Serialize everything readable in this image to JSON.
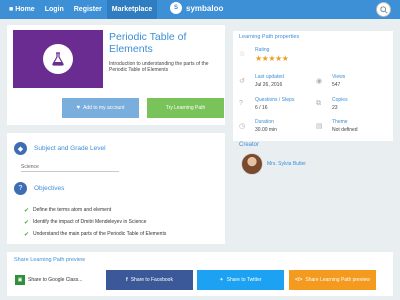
{
  "nav": {
    "home": "Home",
    "login": "Login",
    "register": "Register",
    "marketplace": "Marketplace",
    "logo_text": "symbaloo"
  },
  "path": {
    "title": "Periodic Table of Elements",
    "description": "Introduction to understanding the parts of the Periodic Table of Elements",
    "thumbnail_color": "#6a2c91",
    "add_button": "Add to my account",
    "try_button": "Try Learning Path"
  },
  "subject": {
    "heading": "Subject and Grade Level",
    "value": "Science"
  },
  "objectives": {
    "heading": "Objectives",
    "items": [
      "Define the terms atom and element",
      "Identify the impact of Dmitri Mendeleyev in Science",
      "Understand the main parts of the Periodic Table of Elements"
    ]
  },
  "properties": {
    "title": "Learning Path properties",
    "rating_label": "Rating",
    "rating": 4.5,
    "rating_stars": "★★★★★",
    "last_updated_label": "Last updated",
    "last_updated": "Jul 26, 2016",
    "views_label": "Views",
    "views": "547",
    "questions_label": "Questions / Steps",
    "questions": "6 / 16",
    "copies_label": "Copies",
    "copies": "23",
    "duration_label": "Duration",
    "duration": "30.00 min",
    "theme_label": "Theme",
    "theme": "Not defined"
  },
  "creator": {
    "title": "Creator",
    "name": "Mrs. Sylvia Butler"
  },
  "share": {
    "title": "Share Learning Path preview",
    "google": "Share to Google Class...",
    "facebook": "Share to Facebook",
    "twitter": "Share to Twitter",
    "preview": "Share Learning Path preview"
  },
  "colors": {
    "nav": "#3d8fd6",
    "accent": "#3d8fd6",
    "try": "#79c35a",
    "add": "#7aaedc",
    "facebook": "#3b5998",
    "twitter": "#1da1f2",
    "preview": "#f39a1f",
    "star": "#e9a025"
  }
}
